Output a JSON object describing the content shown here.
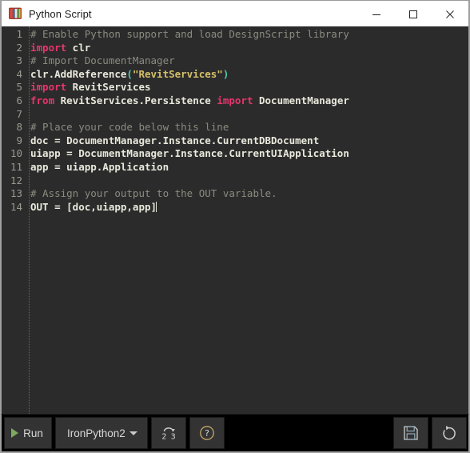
{
  "window": {
    "title": "Python Script",
    "icon": "python-script-icon",
    "controls": [
      {
        "name": "minimize-button",
        "glyph": "minimize-icon"
      },
      {
        "name": "maximize-button",
        "glyph": "maximize-icon"
      },
      {
        "name": "close-button",
        "glyph": "close-icon"
      }
    ]
  },
  "editor": {
    "language": "python",
    "caret_line": 14,
    "caret_col": 22,
    "lines": [
      {
        "n": "1",
        "tokens": [
          {
            "t": "# Enable Python support and load DesignScript library",
            "c": "comment"
          }
        ]
      },
      {
        "n": "2",
        "tokens": [
          {
            "t": "import",
            "c": "keyword"
          },
          {
            "t": " clr",
            "c": "plain"
          }
        ]
      },
      {
        "n": "3",
        "tokens": [
          {
            "t": "# Import DocumentManager",
            "c": "comment"
          }
        ]
      },
      {
        "n": "4",
        "tokens": [
          {
            "t": "clr.AddReference",
            "c": "plain"
          },
          {
            "t": "(",
            "c": "paren"
          },
          {
            "t": "\"RevitServices\"",
            "c": "string"
          },
          {
            "t": ")",
            "c": "paren"
          }
        ]
      },
      {
        "n": "5",
        "tokens": [
          {
            "t": "import",
            "c": "keyword"
          },
          {
            "t": " RevitServices",
            "c": "plain"
          }
        ]
      },
      {
        "n": "6",
        "tokens": [
          {
            "t": "from",
            "c": "keyword"
          },
          {
            "t": " RevitServices.Persistence ",
            "c": "plain"
          },
          {
            "t": "import",
            "c": "keyword"
          },
          {
            "t": " DocumentManager",
            "c": "plain"
          }
        ]
      },
      {
        "n": "7",
        "tokens": [
          {
            "t": "",
            "c": "plain"
          }
        ]
      },
      {
        "n": "8",
        "tokens": [
          {
            "t": "# Place your code below this line",
            "c": "comment"
          }
        ]
      },
      {
        "n": "9",
        "tokens": [
          {
            "t": "doc = DocumentManager.Instance.CurrentDBDocument",
            "c": "plain"
          }
        ]
      },
      {
        "n": "10",
        "tokens": [
          {
            "t": "uiapp = DocumentManager.Instance.CurrentUIApplication",
            "c": "plain"
          }
        ]
      },
      {
        "n": "11",
        "tokens": [
          {
            "t": "app = uiapp.Application",
            "c": "plain"
          }
        ]
      },
      {
        "n": "12",
        "tokens": [
          {
            "t": "",
            "c": "plain"
          }
        ]
      },
      {
        "n": "13",
        "tokens": [
          {
            "t": "# Assign your output to the OUT variable.",
            "c": "comment"
          }
        ]
      },
      {
        "n": "14",
        "tokens": [
          {
            "t": "OUT = [doc,uiapp,app]",
            "c": "plain"
          }
        ],
        "caret": true
      }
    ]
  },
  "toolbar": {
    "run_label": "Run",
    "run_icon": "play-icon",
    "engine_label": "IronPython2",
    "engine_dropdown_icon": "chevron-down-icon",
    "migrate_icon": "python-2-to-3-icon",
    "migrate_from": "2",
    "migrate_to": "3",
    "help_icon": "help-circle-icon",
    "save_icon": "save-floppy-icon",
    "revert_icon": "revert-arrow-icon"
  },
  "colors": {
    "editor_background": "#2b2b2b",
    "toolbar_background": "#000000",
    "button_background": "#333333",
    "titlebar_background": "#ffffff",
    "comment": "#8a8c80",
    "keyword": "#e8356d",
    "string": "#d4c06a",
    "paren": "#4ec9b0",
    "code_text": "#e8e8dc",
    "line_number": "#999b8e",
    "run_accent": "#7fa85f",
    "help_accent": "#c9a86a"
  }
}
